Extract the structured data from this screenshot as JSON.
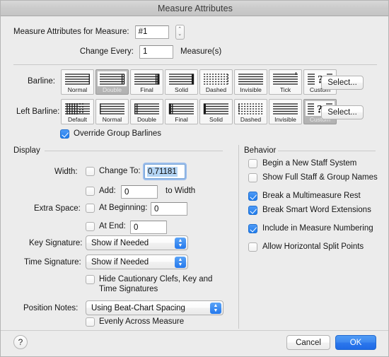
{
  "window": {
    "title": "Measure Attributes"
  },
  "top": {
    "measure_label": "Measure Attributes for Measure:",
    "measure_value": "#1",
    "stepper_up": "⌃",
    "stepper_down": "⌄",
    "change_every_label": "Change Every:",
    "change_every_value": "1",
    "change_every_suffix": "Measure(s)"
  },
  "barline": {
    "label": "Barline:",
    "select_label": "Select...",
    "selected_index": 1,
    "options": [
      {
        "label": "Normal",
        "icon": "barline-normal-icon"
      },
      {
        "label": "Double",
        "icon": "barline-double-icon"
      },
      {
        "label": "Final",
        "icon": "barline-final-icon"
      },
      {
        "label": "Solid",
        "icon": "barline-solid-icon"
      },
      {
        "label": "Dashed",
        "icon": "barline-dashed-icon"
      },
      {
        "label": "Invisible",
        "icon": "barline-invisible-icon"
      },
      {
        "label": "Tick",
        "icon": "barline-tick-icon"
      },
      {
        "label": "Custom",
        "icon": "barline-custom-icon"
      }
    ]
  },
  "left_barline": {
    "label": "Left Barline:",
    "select_label": "Select...",
    "selected_index": 7,
    "options": [
      {
        "label": "Default",
        "icon": "left-barline-default-icon"
      },
      {
        "label": "Normal",
        "icon": "left-barline-normal-icon"
      },
      {
        "label": "Double",
        "icon": "left-barline-double-icon"
      },
      {
        "label": "Final",
        "icon": "left-barline-final-icon"
      },
      {
        "label": "Solid",
        "icon": "left-barline-solid-icon"
      },
      {
        "label": "Dashed",
        "icon": "left-barline-dashed-icon"
      },
      {
        "label": "Invisible",
        "icon": "left-barline-invisible-icon"
      },
      {
        "label": "Custom",
        "icon": "left-barline-custom-icon"
      }
    ]
  },
  "override_group_barlines": {
    "label": "Override Group Barlines",
    "checked": true
  },
  "display": {
    "title": "Display",
    "width_label": "Width:",
    "change_to_label": "Change To:",
    "change_to_checked": false,
    "change_to_value": "0,71181",
    "add_label": "Add:",
    "add_checked": false,
    "add_value": "0",
    "add_suffix": "to Width",
    "extra_space_label": "Extra Space:",
    "at_beginning_label": "At Beginning:",
    "at_beginning_checked": false,
    "at_beginning_value": "0",
    "at_end_label": "At End:",
    "at_end_checked": false,
    "at_end_value": "0",
    "key_signature_label": "Key Signature:",
    "key_signature_value": "Show if Needed",
    "time_signature_label": "Time Signature:",
    "time_signature_value": "Show if Needed",
    "hide_cautionary_line1": "Hide Cautionary Clefs, Key and",
    "hide_cautionary_line2": "Time Signatures",
    "hide_cautionary_checked": false,
    "position_notes_label": "Position Notes:",
    "position_notes_value": "Using Beat-Chart Spacing",
    "evenly_across_label": "Evenly Across Measure",
    "evenly_across_checked": false
  },
  "behavior": {
    "title": "Behavior",
    "items": [
      {
        "label": "Begin a New Staff System",
        "checked": false
      },
      {
        "label": "Show Full Staff & Group Names",
        "checked": false
      },
      {
        "label": "Break a Multimeasure Rest",
        "checked": true
      },
      {
        "label": "Break Smart Word Extensions",
        "checked": true
      },
      {
        "label": "Include in Measure Numbering",
        "checked": true
      },
      {
        "label": "Allow Horizontal Split Points",
        "checked": false
      }
    ]
  },
  "footer": {
    "help_label": "?",
    "cancel_label": "Cancel",
    "ok_label": "OK"
  },
  "colors": {
    "accent": "#2478ec",
    "window_bg": "#ececec",
    "selection": "#b4d5f5"
  }
}
